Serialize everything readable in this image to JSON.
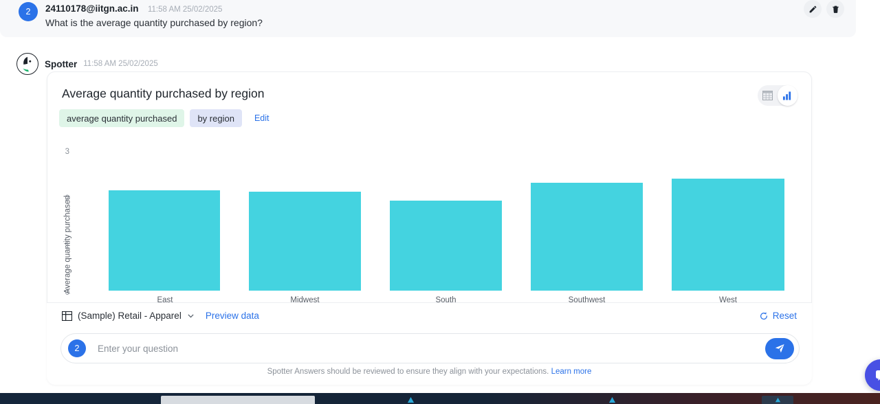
{
  "user_message": {
    "avatar_initial": "2",
    "email": "24110178@iitgn.ac.in",
    "timestamp": "11:58 AM 25/02/2025",
    "text": "What is the average quantity purchased by region?",
    "edit_icon": "pencil-icon",
    "delete_icon": "trash-icon"
  },
  "assistant": {
    "name": "Spotter",
    "timestamp": "11:58 AM 25/02/2025",
    "logo_icon": "spotter-logo-icon"
  },
  "answer_card": {
    "title": "Average quantity purchased by region",
    "chips": [
      {
        "label": "average quantity purchased",
        "kind": "measure"
      },
      {
        "label": "by region",
        "kind": "attribute"
      }
    ],
    "edit_label": "Edit",
    "view_toggle": {
      "table_icon": "table-icon",
      "chart_icon": "bar-chart-icon",
      "active": "chart"
    }
  },
  "footer": {
    "source_icon": "table-icon",
    "source_name": "(Sample) Retail - Apparel",
    "chevron_icon": "chevron-down-icon",
    "preview_label": "Preview data",
    "reset_label": "Reset",
    "reset_icon": "refresh-icon",
    "ask": {
      "avatar_initial": "2",
      "placeholder": "Enter your question",
      "value": "",
      "send_icon": "send-icon"
    },
    "disclaimer": "Spotter Answers should be reviewed to ensure they align with your expectations.",
    "learn_more": "Learn more"
  },
  "floating_chat": {
    "icon": "chat-bubble-icon"
  },
  "colors": {
    "bar": "#44d3e0",
    "accent_blue": "#2b72e8",
    "chip_measure_bg": "#dff5e8",
    "chip_attribute_bg": "#dfe4f7",
    "fab": "#4850e4"
  },
  "chart_data": {
    "type": "bar",
    "title": "Average quantity purchased by region",
    "xlabel": "",
    "ylabel": "Average quantity purchased",
    "categories": [
      "East",
      "Midwest",
      "South",
      "Southwest",
      "West"
    ],
    "values": [
      2.13,
      2.1,
      1.91,
      2.29,
      2.38
    ],
    "ylim": [
      0,
      3
    ],
    "yticks": [
      0,
      1,
      2,
      3
    ],
    "grid": false,
    "legend": false,
    "series": [
      {
        "name": "Average quantity purchased",
        "values": [
          2.13,
          2.1,
          1.91,
          2.29,
          2.38
        ]
      }
    ]
  }
}
